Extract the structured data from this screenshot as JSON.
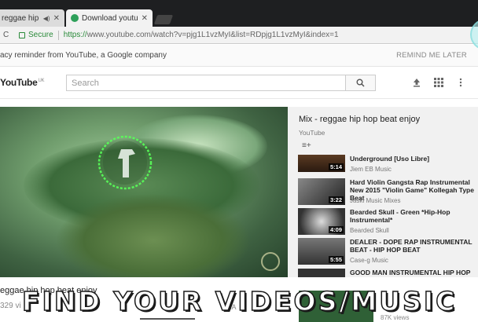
{
  "browser": {
    "tabs": [
      {
        "label": "reggae hip hop beat",
        "audio": true
      },
      {
        "label": "Download youtube play"
      }
    ],
    "address": {
      "secure_label": "Secure",
      "url_scheme": "https://",
      "url_rest": "www.youtube.com/watch?v=pjg1L1vzMyI&list=RDpjg1L1vzMyI&index=1"
    }
  },
  "infobar": {
    "text": "acy reminder from YouTube, a Google company",
    "action": "REMIND ME LATER"
  },
  "youtube": {
    "logo_text": "YouTube",
    "logo_sup": "UK",
    "search_placeholder": "Search"
  },
  "playlist": {
    "title": "Mix - reggae hip hop beat enjoy",
    "owner": "YouTube",
    "items": [
      {
        "title": "Underground [Uso Libre]",
        "channel": "Jiem EB Music",
        "duration": "5:14"
      },
      {
        "title": "Hard Violin Gangsta Rap Instrumental New 2015 \"Violin Game\" Kollegah Type Beat",
        "channel": "Jaski Music Mixes",
        "duration": "3:22"
      },
      {
        "title": "Bearded Skull - Green *Hip-Hop Instrumental*",
        "channel": "Bearded Skull",
        "duration": "4:09"
      },
      {
        "title": "DEALER - DOPE RAP INSTRUMENTAL BEAT - HIP HOP BEAT",
        "channel": "Case-g Music",
        "duration": "5:55"
      },
      {
        "title": "GOOD MAN INSTRUMENTAL HIP HOP RAP"
      }
    ]
  },
  "video": {
    "title_partial": "eggae hip hop beat enjoy",
    "views_partial": "329 vi",
    "share_partial": "SHA",
    "rec_views": "87K views"
  },
  "overlay_text": "FIND YOUR VIDEOS/MUSIC"
}
